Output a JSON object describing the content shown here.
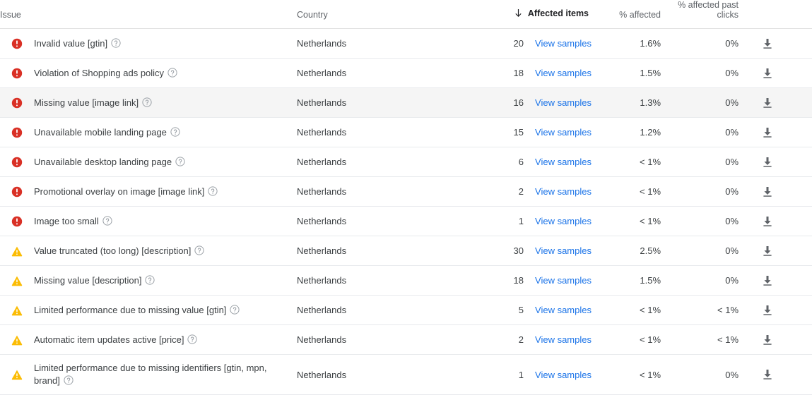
{
  "table": {
    "columns": {
      "issue": "Issue",
      "country": "Country",
      "affected_items": "Affected items",
      "pct_affected": "% affected",
      "pct_affected_past_clicks": "% affected past clicks"
    },
    "sort": {
      "column": "Affected items",
      "direction": "descending",
      "icon": "arrow-down-icon"
    },
    "link_label": "View samples",
    "row_action_icon": "download-icon",
    "help_icon": "help-circle-icon",
    "colors": {
      "error": "#d93025",
      "warning": "#fbbc04",
      "link": "#1a73e8",
      "text": "#3c4043",
      "header_text": "#5f6368",
      "row_hover": "#f5f5f5",
      "border": "#e8eaed"
    },
    "rows": [
      {
        "severity": "error",
        "severity_icon": "error-circle-icon",
        "issue": "Invalid value [gtin]",
        "country": "Netherlands",
        "affected_items": "20",
        "pct_affected": "1.6%",
        "pct_affected_past_clicks": "0%",
        "hovered": false
      },
      {
        "severity": "error",
        "severity_icon": "error-circle-icon",
        "issue": "Violation of Shopping ads policy",
        "country": "Netherlands",
        "affected_items": "18",
        "pct_affected": "1.5%",
        "pct_affected_past_clicks": "0%",
        "hovered": false
      },
      {
        "severity": "error",
        "severity_icon": "error-circle-icon",
        "issue": "Missing value [image link]",
        "country": "Netherlands",
        "affected_items": "16",
        "pct_affected": "1.3%",
        "pct_affected_past_clicks": "0%",
        "hovered": true
      },
      {
        "severity": "error",
        "severity_icon": "error-circle-icon",
        "issue": "Unavailable mobile landing page",
        "country": "Netherlands",
        "affected_items": "15",
        "pct_affected": "1.2%",
        "pct_affected_past_clicks": "0%",
        "hovered": false
      },
      {
        "severity": "error",
        "severity_icon": "error-circle-icon",
        "issue": "Unavailable desktop landing page",
        "country": "Netherlands",
        "affected_items": "6",
        "pct_affected": "< 1%",
        "pct_affected_past_clicks": "0%",
        "hovered": false
      },
      {
        "severity": "error",
        "severity_icon": "error-circle-icon",
        "issue": "Promotional overlay on image [image link]",
        "country": "Netherlands",
        "affected_items": "2",
        "pct_affected": "< 1%",
        "pct_affected_past_clicks": "0%",
        "hovered": false
      },
      {
        "severity": "error",
        "severity_icon": "error-circle-icon",
        "issue": "Image too small",
        "country": "Netherlands",
        "affected_items": "1",
        "pct_affected": "< 1%",
        "pct_affected_past_clicks": "0%",
        "hovered": false
      },
      {
        "severity": "warning",
        "severity_icon": "warning-triangle-icon",
        "issue": "Value truncated (too long) [description]",
        "country": "Netherlands",
        "affected_items": "30",
        "pct_affected": "2.5%",
        "pct_affected_past_clicks": "0%",
        "hovered": false
      },
      {
        "severity": "warning",
        "severity_icon": "warning-triangle-icon",
        "issue": "Missing value [description]",
        "country": "Netherlands",
        "affected_items": "18",
        "pct_affected": "1.5%",
        "pct_affected_past_clicks": "0%",
        "hovered": false
      },
      {
        "severity": "warning",
        "severity_icon": "warning-triangle-icon",
        "issue": "Limited performance due to missing value [gtin]",
        "country": "Netherlands",
        "affected_items": "5",
        "pct_affected": "< 1%",
        "pct_affected_past_clicks": "< 1%",
        "hovered": false
      },
      {
        "severity": "warning",
        "severity_icon": "warning-triangle-icon",
        "issue": "Automatic item updates active [price]",
        "country": "Netherlands",
        "affected_items": "2",
        "pct_affected": "< 1%",
        "pct_affected_past_clicks": "< 1%",
        "hovered": false
      },
      {
        "severity": "warning",
        "severity_icon": "warning-triangle-icon",
        "issue": "Limited performance due to missing identifiers [gtin, mpn, brand]",
        "country": "Netherlands",
        "affected_items": "1",
        "pct_affected": "< 1%",
        "pct_affected_past_clicks": "0%",
        "hovered": false,
        "tall": true
      }
    ]
  }
}
